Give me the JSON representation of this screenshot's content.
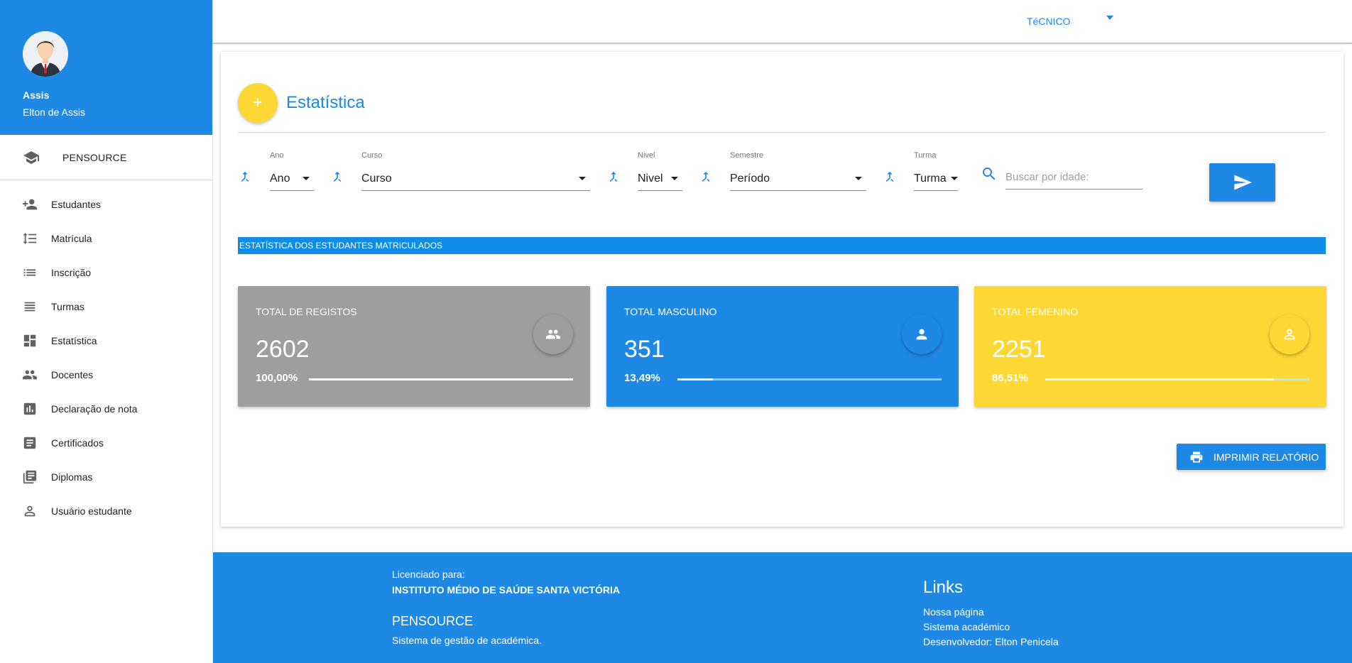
{
  "sidebar": {
    "user_short": "Assis",
    "user_full": "Elton de Assis",
    "brand": "PENSOURCE",
    "items": [
      {
        "label": "Estudantes",
        "icon": "person-add-icon"
      },
      {
        "label": "Matrícula",
        "icon": "format-line-spacing-icon"
      },
      {
        "label": "Inscrição",
        "icon": "list-icon"
      },
      {
        "label": "Turmas",
        "icon": "view-headline-icon"
      },
      {
        "label": "Estatística",
        "icon": "dashboard-icon"
      },
      {
        "label": "Docentes",
        "icon": "people-icon"
      },
      {
        "label": "Declaração de nota",
        "icon": "assessment-icon"
      },
      {
        "label": "Certificados",
        "icon": "list-alt-icon"
      },
      {
        "label": "Diplomas",
        "icon": "library-books-icon"
      },
      {
        "label": "Usuário estudante",
        "icon": "person-outline-icon"
      }
    ]
  },
  "topbar": {
    "role": "TéCNICO"
  },
  "page": {
    "title": "Estatística",
    "fab_symbol": "+"
  },
  "filters": {
    "ano": {
      "label": "Ano",
      "value": "Ano"
    },
    "curso": {
      "label": "Curso",
      "value": "Curso"
    },
    "nivel": {
      "label": "Nivel",
      "value": "Nivel"
    },
    "semestre": {
      "label": "Semestre",
      "value": "Período"
    },
    "turma": {
      "label": "Turma",
      "value": "Turma"
    },
    "search_placeholder": "Buscar por idade:"
  },
  "section": {
    "banner": "ESTATÍSTICA DOS ESTUDANTES MATRICULADOS"
  },
  "stats": [
    {
      "label": "TOTAL DE REGISTOS",
      "value": "2602",
      "percent_text": "100,00%",
      "percent": 100,
      "color": "#9e9e9e",
      "icon": "group-icon"
    },
    {
      "label": "TOTAL MASCULINO",
      "value": "351",
      "percent_text": "13,49%",
      "percent": 13.49,
      "color": "#1e88e5",
      "icon": "person-icon"
    },
    {
      "label": "TOTAL FEMENINO",
      "value": "2251",
      "percent_text": "86,51%",
      "percent": 86.51,
      "color": "#fdd835",
      "icon": "person-outline-icon"
    }
  ],
  "actions": {
    "print": "IMPRIMIR RELATÓRIO"
  },
  "footer": {
    "licensed_for": "Licenciado para:",
    "institution": "INSTITUTO MÉDIO DE SAÚDE SANTA VICTÓRIA",
    "brand": "PENSOURCE",
    "description": "Sistema de gestão de académica.",
    "links_title": "Links",
    "links": [
      "Nossa página",
      "Sistema académico",
      "Desenvolvedor: Elton Penicela"
    ]
  }
}
